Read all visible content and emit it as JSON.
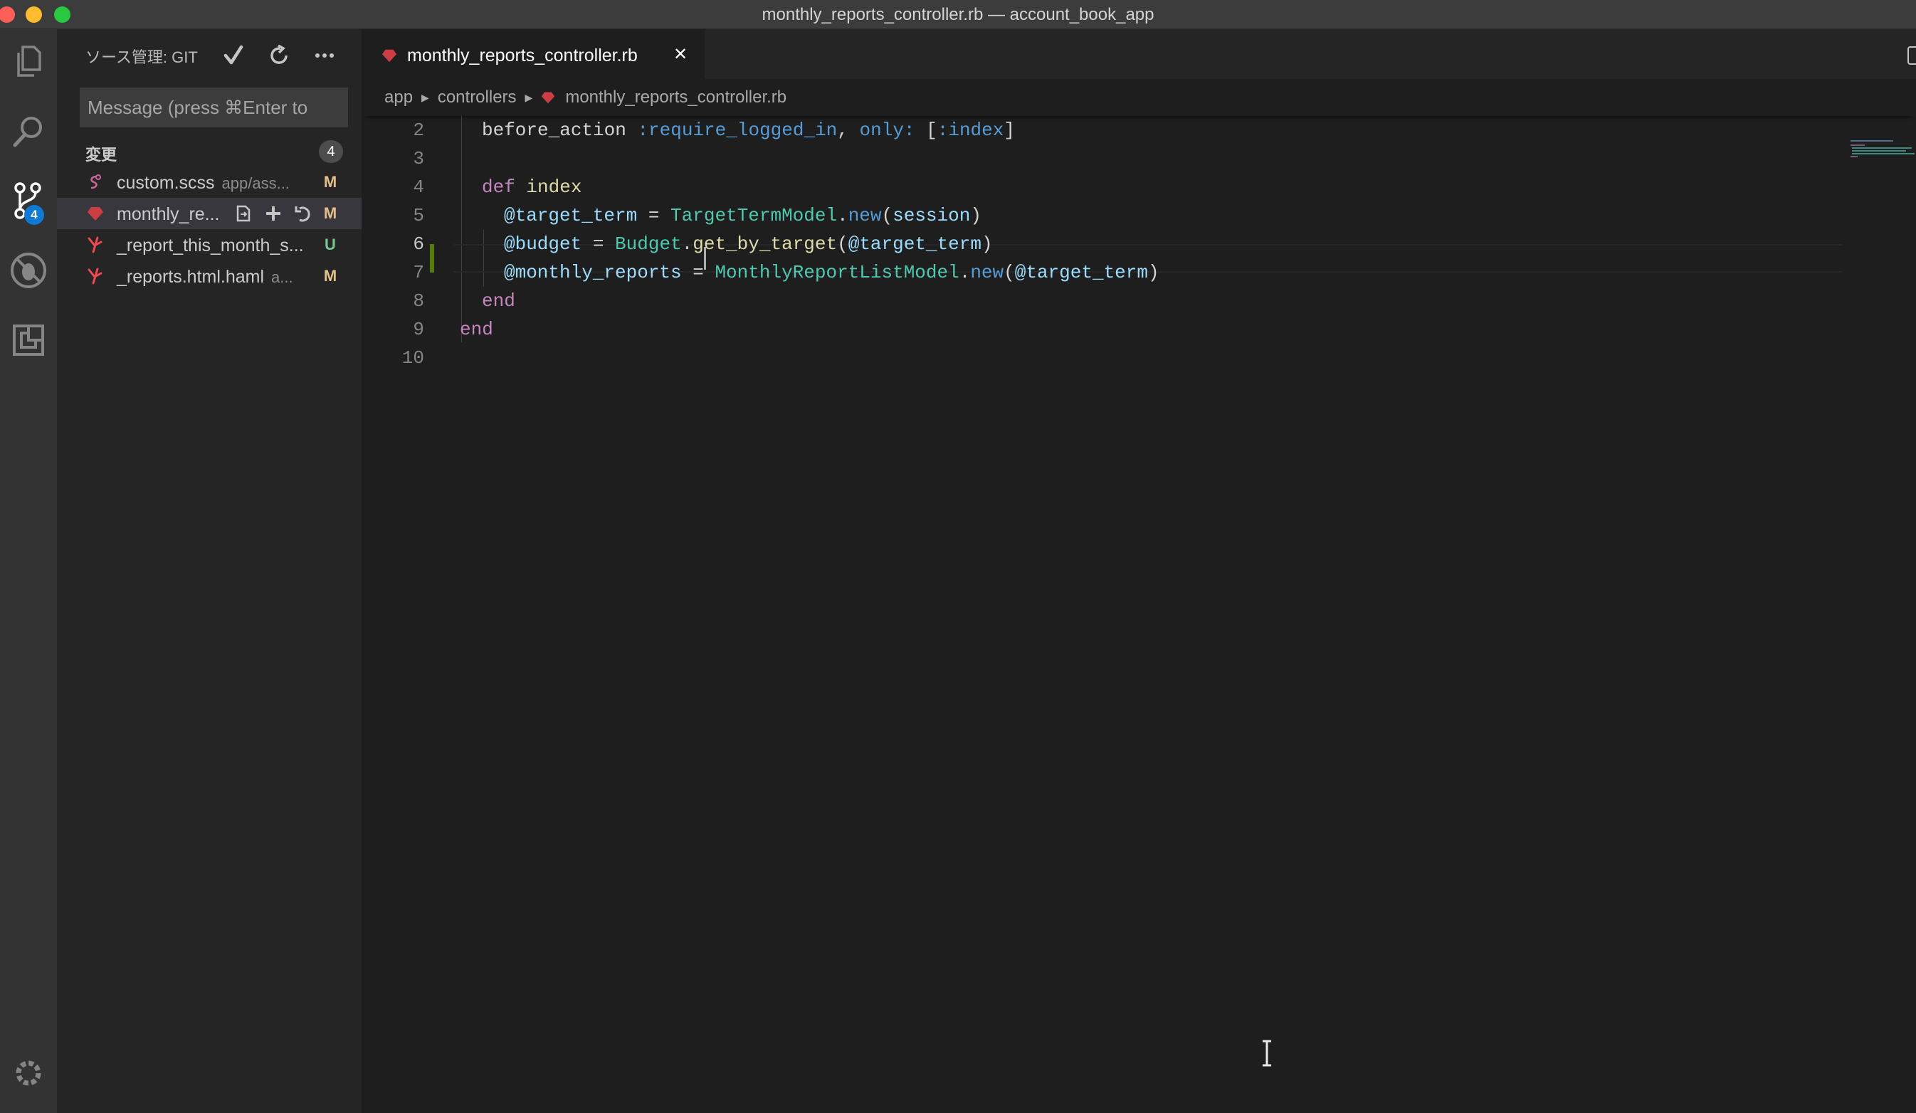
{
  "window": {
    "title": "monthly_reports_controller.rb — account_book_app"
  },
  "activity_bar": {
    "items": [
      {
        "icon": "files-icon"
      },
      {
        "icon": "search-icon"
      },
      {
        "icon": "source-control-icon",
        "badge": "4"
      },
      {
        "icon": "debug-icon"
      },
      {
        "icon": "extensions-icon"
      }
    ],
    "bottom_icon": "gear-icon"
  },
  "sidebar": {
    "title": "ソース管理: GIT",
    "actions": [
      "commit-checkmark-icon",
      "refresh-icon",
      "more-icon"
    ],
    "commit_placeholder": "Message (press ⌘Enter to",
    "group_label": "変更",
    "group_count": "4",
    "files": [
      {
        "name": "custom.scss",
        "dir": "app/ass...",
        "status": "M",
        "icon": "sass-file-icon"
      },
      {
        "name": "monthly_re...",
        "dir": "",
        "status": "M",
        "icon": "ruby-file-icon"
      },
      {
        "name": "_report_this_month_s...",
        "dir": "",
        "status": "U",
        "icon": "haml-file-icon"
      },
      {
        "name": "_reports.html.haml",
        "dir": "a...",
        "status": "M",
        "icon": "haml-file-icon"
      }
    ],
    "row_actions": [
      "open-file-icon",
      "stage-plus-icon",
      "discard-changes-icon"
    ]
  },
  "editor": {
    "tab_label": "monthly_reports_controller.rb",
    "tab_close": "✕",
    "breadcrumb": [
      "app",
      "controllers",
      "monthly_reports_controller.rb"
    ],
    "line_numbers": [
      "2",
      "3",
      "4",
      "5",
      "6",
      "7",
      "8",
      "9",
      "10"
    ],
    "active_line": "6",
    "code": {
      "l2_a": "before_action ",
      "l2_b": ":require_logged_in",
      "l2_c": ", ",
      "l2_d": "only:",
      "l2_e": " [",
      "l2_f": ":index",
      "l2_g": "]",
      "l4_a": "def",
      "l4_b": " index",
      "l5_a": "@target_term",
      "l5_b": " = ",
      "l5_c": "TargetTermModel",
      "l5_d": ".",
      "l5_e": "new",
      "l5_f": "(",
      "l5_g": "session",
      "l5_h": ")",
      "l6_a": "@budget",
      "l6_b": " = ",
      "l6_c": "Budget",
      "l6_d": ".",
      "l6_e": "get_by_target",
      "l6_f": "(",
      "l6_g": "@target_term",
      "l6_h": ")",
      "l7_a": "@monthly_reports",
      "l7_b": " = ",
      "l7_c": "MonthlyReportListModel",
      "l7_d": ".",
      "l7_e": "new",
      "l7_f": "(",
      "l7_g": "@target_term",
      "l7_h": ")",
      "l8_a": "end",
      "l9_a": "end"
    }
  },
  "colors": {
    "background": "#1e1e1e",
    "sidebar": "#252526",
    "activity_bar": "#333333",
    "badge": "#0e7ad3",
    "modified": "#e2c08d",
    "untracked": "#73c991",
    "ruby_red": "#cc3e44"
  }
}
